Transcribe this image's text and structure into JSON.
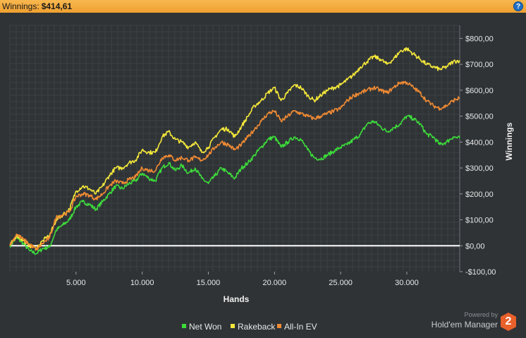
{
  "header": {
    "label": "Winnings:",
    "value": "$414,61",
    "help_icon": "?"
  },
  "branding": {
    "powered_by": "Powered by",
    "product": "Hold'em Manager",
    "logo_text": "2"
  },
  "colors": {
    "background": "#2f3336",
    "plot_background": "#2f3336",
    "grid": "#3b4044",
    "net_won": "#3ddc3a",
    "rakeback": "#f5e83a",
    "all_in_ev": "#f08a33",
    "zero_line": "#ffffff"
  },
  "chart_data": {
    "type": "line",
    "title": "",
    "xlabel": "Hands",
    "ylabel": "Winnings",
    "xlim": [
      0,
      34000
    ],
    "ylim": [
      -100,
      850
    ],
    "x_ticks": [
      5000,
      10000,
      15000,
      20000,
      25000,
      30000
    ],
    "x_tick_labels": [
      "5.000",
      "10.000",
      "15.000",
      "20.000",
      "25.000",
      "30.000"
    ],
    "y_ticks": [
      -100,
      0,
      100,
      200,
      300,
      400,
      500,
      600,
      700,
      800
    ],
    "y_tick_labels": [
      "-$100,00",
      "$0,00",
      "$100,00",
      "$200,00",
      "$300,00",
      "$400,00",
      "$500,00",
      "$600,00",
      "$700,00",
      "$800,00"
    ],
    "grid": true,
    "legend_position": "bottom-center",
    "series": [
      {
        "name": "Net Won",
        "color": "#3ddc3a",
        "x": [
          0,
          500,
          1000,
          1500,
          2000,
          2500,
          3000,
          3500,
          4000,
          4500,
          5000,
          5500,
          6000,
          6500,
          7000,
          7500,
          8000,
          8500,
          9000,
          9500,
          10000,
          10500,
          11000,
          11500,
          12000,
          12500,
          13000,
          13500,
          14000,
          14500,
          15000,
          15500,
          16000,
          16500,
          17000,
          17500,
          18000,
          18500,
          19000,
          19500,
          20000,
          20500,
          21000,
          21500,
          22000,
          22500,
          23000,
          23500,
          24000,
          24500,
          25000,
          25500,
          26000,
          26500,
          27000,
          27500,
          28000,
          28500,
          29000,
          29500,
          30000,
          30500,
          31000,
          31500,
          32000,
          32500,
          33000,
          33500,
          34000
        ],
        "values": [
          0,
          30,
          10,
          -20,
          -30,
          -10,
          -5,
          60,
          80,
          100,
          150,
          170,
          160,
          140,
          170,
          200,
          230,
          220,
          240,
          250,
          280,
          260,
          250,
          300,
          320,
          290,
          310,
          280,
          300,
          260,
          240,
          270,
          300,
          280,
          260,
          300,
          320,
          350,
          380,
          410,
          420,
          380,
          400,
          420,
          410,
          370,
          340,
          335,
          350,
          365,
          380,
          390,
          410,
          430,
          470,
          480,
          460,
          440,
          455,
          470,
          500,
          490,
          470,
          430,
          420,
          390,
          400,
          420,
          415
        ]
      },
      {
        "name": "Rakeback",
        "color": "#f5e83a",
        "x": [
          0,
          500,
          1000,
          1500,
          2000,
          2500,
          3000,
          3500,
          4000,
          4500,
          5000,
          5500,
          6000,
          6500,
          7000,
          7500,
          8000,
          8500,
          9000,
          9500,
          10000,
          10500,
          11000,
          11500,
          12000,
          12500,
          13000,
          13500,
          14000,
          14500,
          15000,
          15500,
          16000,
          16500,
          17000,
          17500,
          18000,
          18500,
          19000,
          19500,
          20000,
          20500,
          21000,
          21500,
          22000,
          22500,
          23000,
          23500,
          24000,
          24500,
          25000,
          25500,
          26000,
          26500,
          27000,
          27500,
          28000,
          28500,
          29000,
          29500,
          30000,
          30500,
          31000,
          31500,
          32000,
          32500,
          33000,
          33500,
          34000
        ],
        "values": [
          0,
          40,
          20,
          0,
          -10,
          20,
          40,
          100,
          120,
          140,
          210,
          230,
          220,
          200,
          230,
          270,
          300,
          300,
          320,
          330,
          370,
          360,
          360,
          420,
          440,
          410,
          400,
          380,
          400,
          360,
          380,
          420,
          450,
          450,
          420,
          460,
          500,
          540,
          560,
          590,
          610,
          560,
          590,
          620,
          610,
          580,
          560,
          580,
          600,
          610,
          620,
          640,
          660,
          690,
          710,
          730,
          720,
          700,
          720,
          750,
          760,
          740,
          720,
          700,
          690,
          680,
          690,
          710,
          715
        ]
      },
      {
        "name": "All-In EV",
        "color": "#f08a33",
        "x": [
          0,
          500,
          1000,
          1500,
          2000,
          2500,
          3000,
          3500,
          4000,
          4500,
          5000,
          5500,
          6000,
          6500,
          7000,
          7500,
          8000,
          8500,
          9000,
          9500,
          10000,
          10500,
          11000,
          11500,
          12000,
          12500,
          13000,
          13500,
          14000,
          14500,
          15000,
          15500,
          16000,
          16500,
          17000,
          17500,
          18000,
          18500,
          19000,
          19500,
          20000,
          20500,
          21000,
          21500,
          22000,
          22500,
          23000,
          23500,
          24000,
          24500,
          25000,
          25500,
          26000,
          26500,
          27000,
          27500,
          28000,
          28500,
          29000,
          29500,
          30000,
          30500,
          31000,
          31500,
          32000,
          32500,
          33000,
          33500,
          34000
        ],
        "values": [
          0,
          45,
          25,
          5,
          -15,
          10,
          30,
          110,
          120,
          130,
          190,
          200,
          195,
          180,
          200,
          230,
          250,
          240,
          255,
          265,
          300,
          290,
          290,
          340,
          350,
          330,
          340,
          330,
          340,
          330,
          350,
          380,
          400,
          390,
          370,
          390,
          420,
          450,
          480,
          510,
          520,
          480,
          500,
          520,
          510,
          500,
          490,
          500,
          510,
          520,
          530,
          560,
          580,
          590,
          600,
          610,
          600,
          590,
          610,
          630,
          630,
          610,
          590,
          560,
          540,
          530,
          540,
          560,
          570
        ]
      }
    ]
  }
}
